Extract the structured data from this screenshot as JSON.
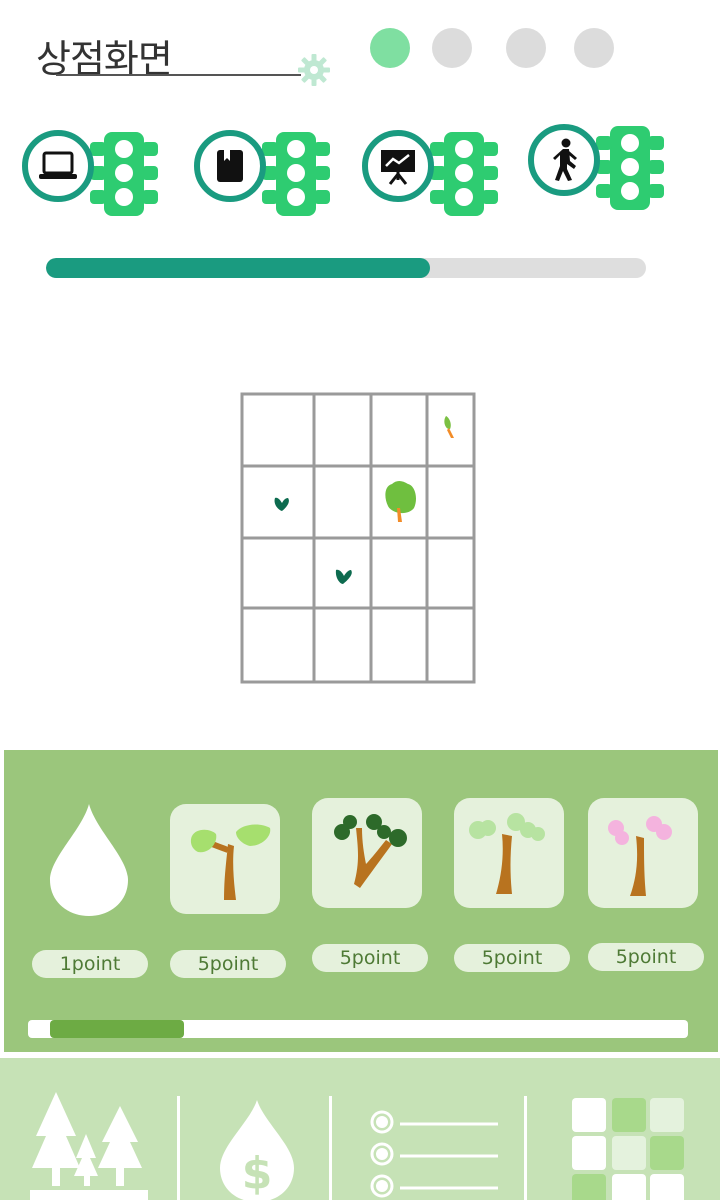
{
  "header": {
    "title": "상점화면",
    "page_indicator": {
      "total": 4,
      "active_index": 0
    }
  },
  "categories": [
    {
      "icon": "laptop-icon"
    },
    {
      "icon": "book-icon"
    },
    {
      "icon": "presentation-icon"
    },
    {
      "icon": "walking-person-icon"
    }
  ],
  "progress": {
    "fraction": 0.64
  },
  "shop": {
    "items": [
      {
        "icon": "water-drop-icon",
        "price": "1point"
      },
      {
        "icon": "green-tree-icon",
        "price": "5point"
      },
      {
        "icon": "dark-green-tree-icon",
        "price": "5point"
      },
      {
        "icon": "light-green-tree-icon",
        "price": "5point"
      },
      {
        "icon": "pink-blossom-tree-icon",
        "price": "5point"
      }
    ],
    "scroll": {
      "fraction": 0.2
    }
  },
  "bottom_nav": [
    {
      "icon": "forest-icon"
    },
    {
      "icon": "money-drop-icon"
    },
    {
      "icon": "list-icon"
    },
    {
      "icon": "grid-icon"
    }
  ],
  "colors": {
    "accent": "#1a9b80",
    "traffic_light": "#2ecc71",
    "active_dot": "#7fdfa1",
    "inactive_dot": "#dcdcdc",
    "shop_bg": "#9bc67c",
    "shop_item_bg": "#e5f1dc",
    "nav_bg": "#c6e2b6"
  }
}
